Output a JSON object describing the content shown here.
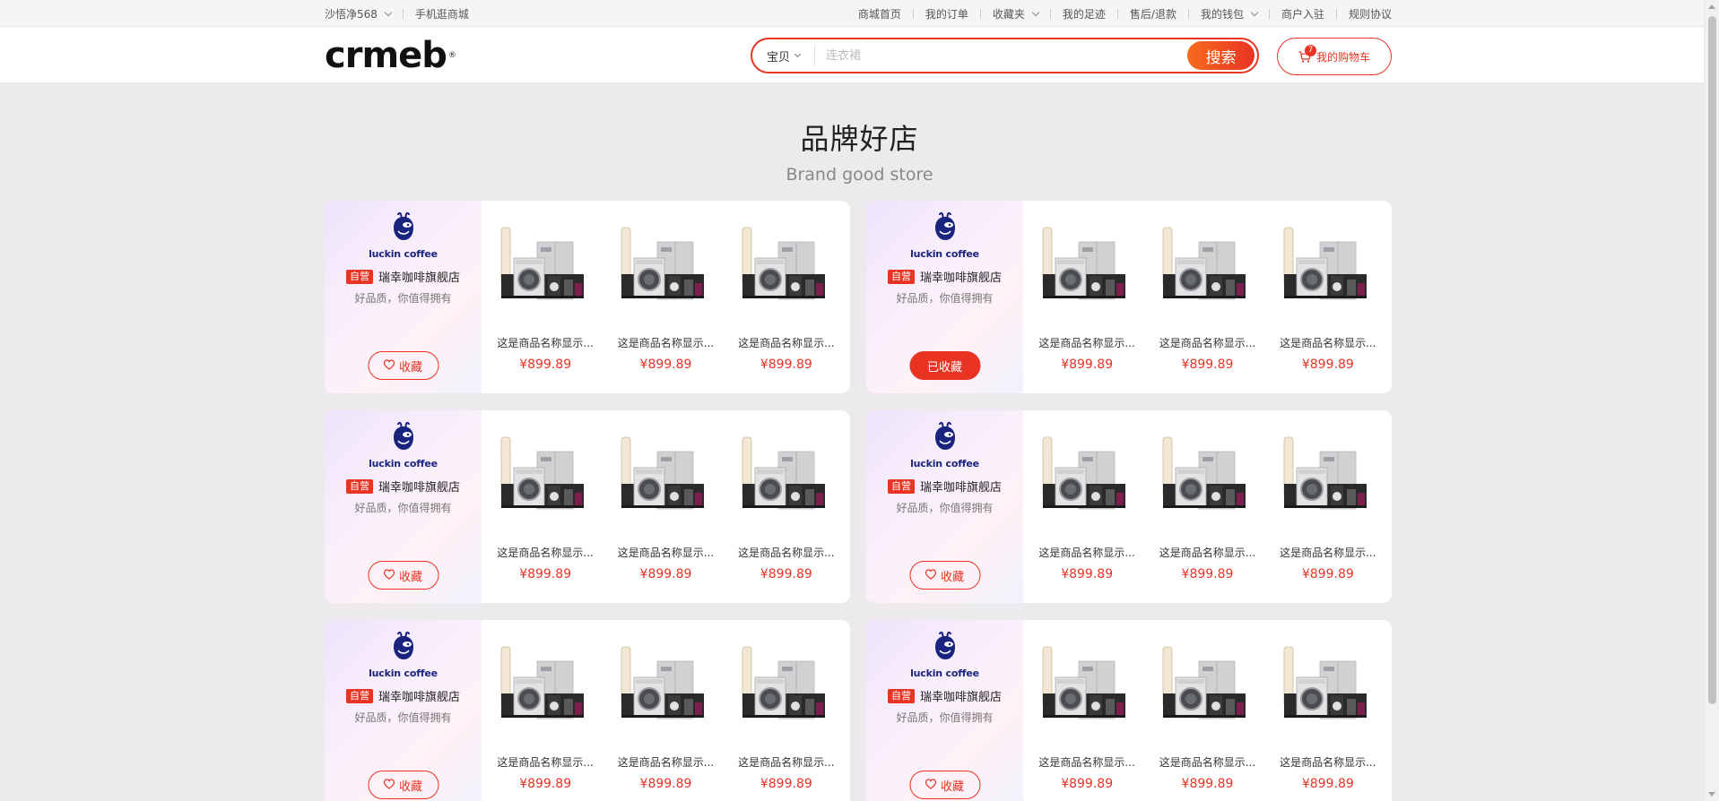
{
  "topbar": {
    "user": "沙悟净568",
    "mobile": "手机逛商城",
    "links": [
      {
        "label": "商城首页",
        "dropdown": false
      },
      {
        "label": "我的订单",
        "dropdown": false
      },
      {
        "label": "收藏夹",
        "dropdown": true
      },
      {
        "label": "我的足迹",
        "dropdown": false
      },
      {
        "label": "售后/退款",
        "dropdown": false
      },
      {
        "label": "我的钱包",
        "dropdown": true
      },
      {
        "label": "商户入驻",
        "dropdown": false
      },
      {
        "label": "规则协议",
        "dropdown": false
      }
    ]
  },
  "header": {
    "logo_text": "crmeb",
    "logo_reg": "®",
    "search_category": "宝贝",
    "search_placeholder": "连衣裙",
    "search_button": "搜索",
    "cart_label": "我的购物车",
    "cart_count": "7"
  },
  "section": {
    "title": "品牌好店",
    "subtitle": "Brand good store"
  },
  "stores": [
    {
      "wordmark": "luckin coffee",
      "tag": "自营",
      "name": "瑞幸咖啡旗舰店",
      "slogan": "好品质，你值得拥有",
      "fav_label": "收藏",
      "favorited": false,
      "products": [
        {
          "name": "这是商品名称显示...",
          "price": "¥899.89"
        },
        {
          "name": "这是商品名称显示...",
          "price": "¥899.89"
        },
        {
          "name": "这是商品名称显示...",
          "price": "¥899.89"
        }
      ]
    },
    {
      "wordmark": "luckin coffee",
      "tag": "自营",
      "name": "瑞幸咖啡旗舰店",
      "slogan": "好品质，你值得拥有",
      "fav_label": "已收藏",
      "favorited": true,
      "products": [
        {
          "name": "这是商品名称显示...",
          "price": "¥899.89"
        },
        {
          "name": "这是商品名称显示...",
          "price": "¥899.89"
        },
        {
          "name": "这是商品名称显示...",
          "price": "¥899.89"
        }
      ]
    },
    {
      "wordmark": "luckin coffee",
      "tag": "自营",
      "name": "瑞幸咖啡旗舰店",
      "slogan": "好品质，你值得拥有",
      "fav_label": "收藏",
      "favorited": false,
      "products": [
        {
          "name": "这是商品名称显示...",
          "price": "¥899.89"
        },
        {
          "name": "这是商品名称显示...",
          "price": "¥899.89"
        },
        {
          "name": "这是商品名称显示...",
          "price": "¥899.89"
        }
      ]
    },
    {
      "wordmark": "luckin coffee",
      "tag": "自营",
      "name": "瑞幸咖啡旗舰店",
      "slogan": "好品质，你值得拥有",
      "fav_label": "收藏",
      "favorited": false,
      "products": [
        {
          "name": "这是商品名称显示...",
          "price": "¥899.89"
        },
        {
          "name": "这是商品名称显示...",
          "price": "¥899.89"
        },
        {
          "name": "这是商品名称显示...",
          "price": "¥899.89"
        }
      ]
    },
    {
      "wordmark": "luckin coffee",
      "tag": "自营",
      "name": "瑞幸咖啡旗舰店",
      "slogan": "好品质，你值得拥有",
      "fav_label": "收藏",
      "favorited": false,
      "products": [
        {
          "name": "这是商品名称显示...",
          "price": "¥899.89"
        },
        {
          "name": "这是商品名称显示...",
          "price": "¥899.89"
        },
        {
          "name": "这是商品名称显示...",
          "price": "¥899.89"
        }
      ]
    },
    {
      "wordmark": "luckin coffee",
      "tag": "自营",
      "name": "瑞幸咖啡旗舰店",
      "slogan": "好品质，你值得拥有",
      "fav_label": "收藏",
      "favorited": false,
      "products": [
        {
          "name": "这是商品名称显示...",
          "price": "¥899.89"
        },
        {
          "name": "这是商品名称显示...",
          "price": "¥899.89"
        },
        {
          "name": "这是商品名称显示...",
          "price": "¥899.89"
        }
      ]
    }
  ],
  "colors": {
    "accent": "#e93323",
    "brand_blue": "#1a237e"
  }
}
